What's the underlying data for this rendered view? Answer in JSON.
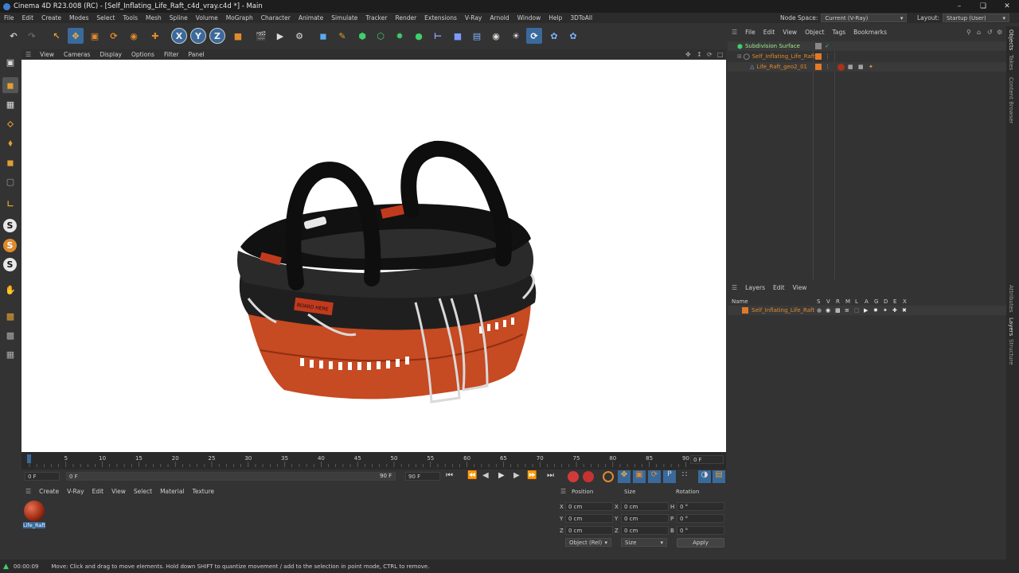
{
  "title_bar": {
    "title": "Cinema 4D R23.008 (RC) - [Self_Inflating_Life_Raft_c4d_vray.c4d *] - Main"
  },
  "menu": [
    "File",
    "Edit",
    "Create",
    "Modes",
    "Select",
    "Tools",
    "Mesh",
    "Spline",
    "Volume",
    "MoGraph",
    "Character",
    "Animate",
    "Simulate",
    "Tracker",
    "Render",
    "Extensions",
    "V-Ray",
    "Arnold",
    "Window",
    "Help",
    "3DToAll"
  ],
  "node_space": {
    "label": "Node Space:",
    "value": "Current (V-Ray)"
  },
  "layout": {
    "label": "Layout:",
    "value": "Startup (User)"
  },
  "viewport_menu": [
    "View",
    "Cameras",
    "Display",
    "Options",
    "Filter",
    "Panel"
  ],
  "viewport_text": {
    "hatch_label": "BOARD HERE"
  },
  "timeline": {
    "ticks": [
      "0",
      "5",
      "10",
      "15",
      "20",
      "25",
      "30",
      "35",
      "40",
      "45",
      "50",
      "55",
      "60",
      "65",
      "70",
      "75",
      "80",
      "85",
      "90"
    ],
    "current_frame": "0 F"
  },
  "transport": {
    "start": "0 F",
    "range_start": "0 F",
    "range_end": "90 F",
    "end": "90 F"
  },
  "material_menu": [
    "Create",
    "V-Ray",
    "Edit",
    "View",
    "Select",
    "Material",
    "Texture"
  ],
  "material": {
    "name": "Life_Raft"
  },
  "coords": {
    "headers": [
      "Position",
      "Size",
      "Rotation"
    ],
    "pos": [
      {
        "axis": "X",
        "value": "0 cm"
      },
      {
        "axis": "Y",
        "value": "0 cm"
      },
      {
        "axis": "Z",
        "value": "0 cm"
      }
    ],
    "size": [
      {
        "axis": "X",
        "value": "0 cm"
      },
      {
        "axis": "Y",
        "value": "0 cm"
      },
      {
        "axis": "Z",
        "value": "0 cm"
      }
    ],
    "rot": [
      {
        "axis": "H",
        "value": "0 °"
      },
      {
        "axis": "P",
        "value": "0 °"
      },
      {
        "axis": "B",
        "value": "0 °"
      }
    ],
    "mode": "Object (Rel)",
    "size_mode": "Size",
    "apply": "Apply"
  },
  "objects_menu": [
    "File",
    "Edit",
    "View",
    "Object",
    "Tags",
    "Bookmarks"
  ],
  "objects": [
    {
      "name": "Subdivision Surface"
    },
    {
      "name": "Self_Inflating_Life_Raft"
    },
    {
      "name": "Life_Raft_geo2_01"
    }
  ],
  "layers_menu": [
    "Layers",
    "Edit",
    "View"
  ],
  "layers_header": {
    "name": "Name",
    "flags": [
      "S",
      "V",
      "R",
      "M",
      "L",
      "A",
      "G",
      "D",
      "E",
      "X"
    ]
  },
  "layers": [
    {
      "name": "Self_Inflating_Life_Raft"
    }
  ],
  "right_tabs": [
    "Objects",
    "Takes",
    "Content Browser",
    "Attributes",
    "Layers",
    "Structure"
  ],
  "status": {
    "time": "00:00:09",
    "message": "Move: Click and drag to move elements. Hold down SHIFT to quantize movement / add to the selection in point mode, CTRL to remove."
  },
  "colors": {
    "accent_blue": "#3a6a9c",
    "orange": "#e08a2e",
    "green": "#4fd06a",
    "raft_red": "#c64a22"
  }
}
